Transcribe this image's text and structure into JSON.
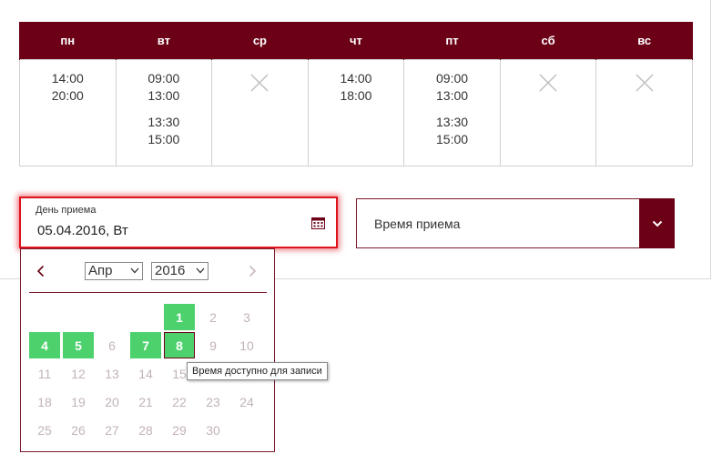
{
  "schedule": {
    "days": [
      "пн",
      "вт",
      "ср",
      "чт",
      "пт",
      "сб",
      "вс"
    ],
    "slots": [
      [
        [
          "14:00",
          "20:00"
        ]
      ],
      [
        [
          "09:00",
          "13:00"
        ],
        [
          "13:30",
          "15:00"
        ]
      ],
      [],
      [
        [
          "14:00",
          "18:00"
        ]
      ],
      [
        [
          "09:00",
          "13:00"
        ],
        [
          "13:30",
          "15:00"
        ]
      ],
      [],
      []
    ]
  },
  "date_field": {
    "label": "День приема",
    "value": "05.04.2016, Вт",
    "icon": "calendar-icon"
  },
  "time_field": {
    "placeholder": "Время приема",
    "icon": "chevron-down-icon"
  },
  "datepicker": {
    "month": "Апр",
    "year": "2016",
    "rows": [
      [
        null,
        null,
        null,
        null,
        {
          "d": "1",
          "s": "avail"
        },
        {
          "d": "2"
        },
        {
          "d": "3"
        }
      ],
      [
        {
          "d": "4",
          "s": "avail"
        },
        {
          "d": "5",
          "s": "avail"
        },
        {
          "d": "6"
        },
        {
          "d": "7",
          "s": "avail"
        },
        {
          "d": "8",
          "s": "selected"
        },
        {
          "d": "9"
        },
        {
          "d": "10"
        }
      ],
      [
        {
          "d": "11"
        },
        {
          "d": "12"
        },
        {
          "d": "13"
        },
        {
          "d": "14"
        },
        {
          "d": "15"
        },
        null,
        null
      ],
      [
        {
          "d": "18"
        },
        {
          "d": "19"
        },
        {
          "d": "20"
        },
        {
          "d": "21"
        },
        {
          "d": "22"
        },
        {
          "d": "23"
        },
        {
          "d": "24"
        }
      ],
      [
        {
          "d": "25"
        },
        {
          "d": "26"
        },
        {
          "d": "27"
        },
        {
          "d": "28"
        },
        {
          "d": "29"
        },
        {
          "d": "30"
        },
        null
      ]
    ]
  },
  "tooltip": {
    "text": "Время доступно для записи"
  },
  "colors": {
    "brand": "#6b0016",
    "available": "#4cd16d",
    "focus": "#e0131c"
  }
}
